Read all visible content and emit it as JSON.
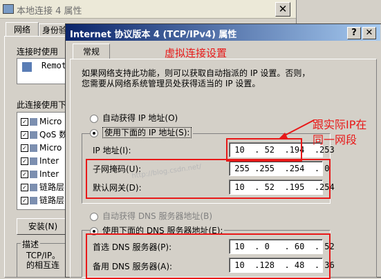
{
  "back_window": {
    "title": "本地连接 4 属性",
    "tabs": [
      "网络",
      "身份验"
    ],
    "connect_label": "连接时使用",
    "adapter_text": "Remot",
    "uses_label": "此连接使用下",
    "items": [
      {
        "text": "Micro",
        "checked": true
      },
      {
        "text": "QoS 数",
        "checked": true
      },
      {
        "text": "Micro",
        "checked": true
      },
      {
        "text": "Inter",
        "checked": true
      },
      {
        "text": "Inter",
        "checked": true
      },
      {
        "text": "链路层",
        "checked": true
      },
      {
        "text": "链路层",
        "checked": true
      }
    ],
    "install_label": "安装(N)",
    "desc_label": "描述",
    "desc_text": "TCP/IP。\n的相互连"
  },
  "dialog": {
    "title": "Internet 协议版本 4 (TCP/IPv4) 属性",
    "help_label": "?",
    "close_label": "✕",
    "tab": "常规",
    "intro": "如果网络支持此功能，则可以获取自动指派的 IP 设置。否则，\n您需要从网络系统管理员处获得适当的 IP 设置。",
    "auto_ip": "自动获得 IP 地址(O)",
    "manual_ip": "使用下面的 IP 地址(S):",
    "ip_label": "IP 地址(I):",
    "ip_value": " 10  . 52  .194  .253",
    "mask_label": "子网掩码(U):",
    "mask_value": " 255 .255  .254  . 0",
    "gateway_label": "默认网关(D):",
    "gateway_value": " 10  . 52  .195  .254",
    "auto_dns": "自动获得 DNS 服务器地址(B)",
    "manual_dns": "使用下面的 DNS 服务器地址(E):",
    "dns1_label": "首选 DNS 服务器(P):",
    "dns1_value": " 10  . 0   . 60  . 52",
    "dns2_label": "备用 DNS 服务器(A):",
    "dns2_value": " 10  .128  . 48  . 36"
  },
  "annotations": {
    "title": "虚拟连接设置",
    "note": "跟实际IP在\n同一网段",
    "color": "#e81818"
  },
  "watermark": "http://blog.csdn.net/"
}
